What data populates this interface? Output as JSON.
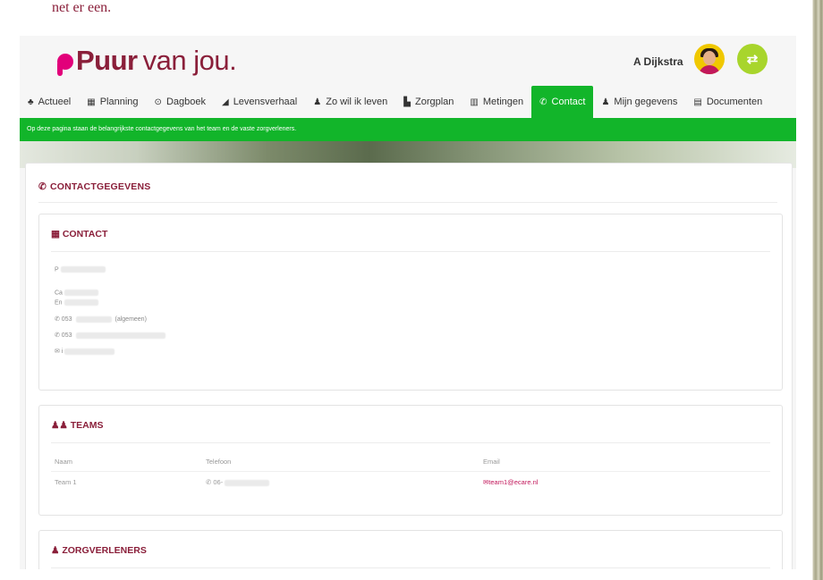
{
  "page_caption": "net er een.",
  "header": {
    "logo": {
      "brand_bold": "Puur",
      "brand_rest": "van jou."
    },
    "user_name": "A Dijkstra",
    "switch_icon": "⇄"
  },
  "nav": {
    "items": [
      {
        "icon": "♣",
        "label": "Actueel"
      },
      {
        "icon": "▦",
        "label": "Planning"
      },
      {
        "icon": "⊙",
        "label": "Dagboek"
      },
      {
        "icon": "◢",
        "label": "Levensverhaal"
      },
      {
        "icon": "♟",
        "label": "Zo wil ik leven"
      },
      {
        "icon": "▙",
        "label": "Zorgplan"
      },
      {
        "icon": "▥",
        "label": "Metingen"
      },
      {
        "icon": "✆",
        "label": "Contact"
      },
      {
        "icon": "♟",
        "label": "Mijn gegevens"
      },
      {
        "icon": "▤",
        "label": "Documenten"
      }
    ],
    "active_index": 7
  },
  "info_text": "Op deze pagina staan de belangrijkste contactgegevens van het team en de vaste zorgverleners.",
  "main": {
    "title_icon": "✆",
    "title": "CONTACTGEGEVENS",
    "contact": {
      "icon": "▦",
      "title": "CONTACT",
      "line1": "P",
      "line2a": "Ca",
      "line2b": "En",
      "phone1_prefix": "✆ 053",
      "phone1_suffix": "(algemeen)",
      "phone2_prefix": "✆ 053",
      "phone2_mid": "",
      "mail_prefix": "✉ i"
    },
    "teams": {
      "icon": "♟♟",
      "title": "TEAMS",
      "columns": [
        "Naam",
        "Telefoon",
        "Email"
      ],
      "rows": [
        {
          "name": "Team 1",
          "phone": "✆ 06-",
          "email": "team1@ecare.nl",
          "email_icon": "✉"
        }
      ]
    },
    "zorgverleners": {
      "icon": "♟",
      "title": "ZORGVERLENERS"
    }
  },
  "colors": {
    "accent_green": "#12b52a",
    "brand_maroon": "#8a1f3a",
    "brand_pink": "#e2007a",
    "switch_green": "#a8d52c"
  }
}
